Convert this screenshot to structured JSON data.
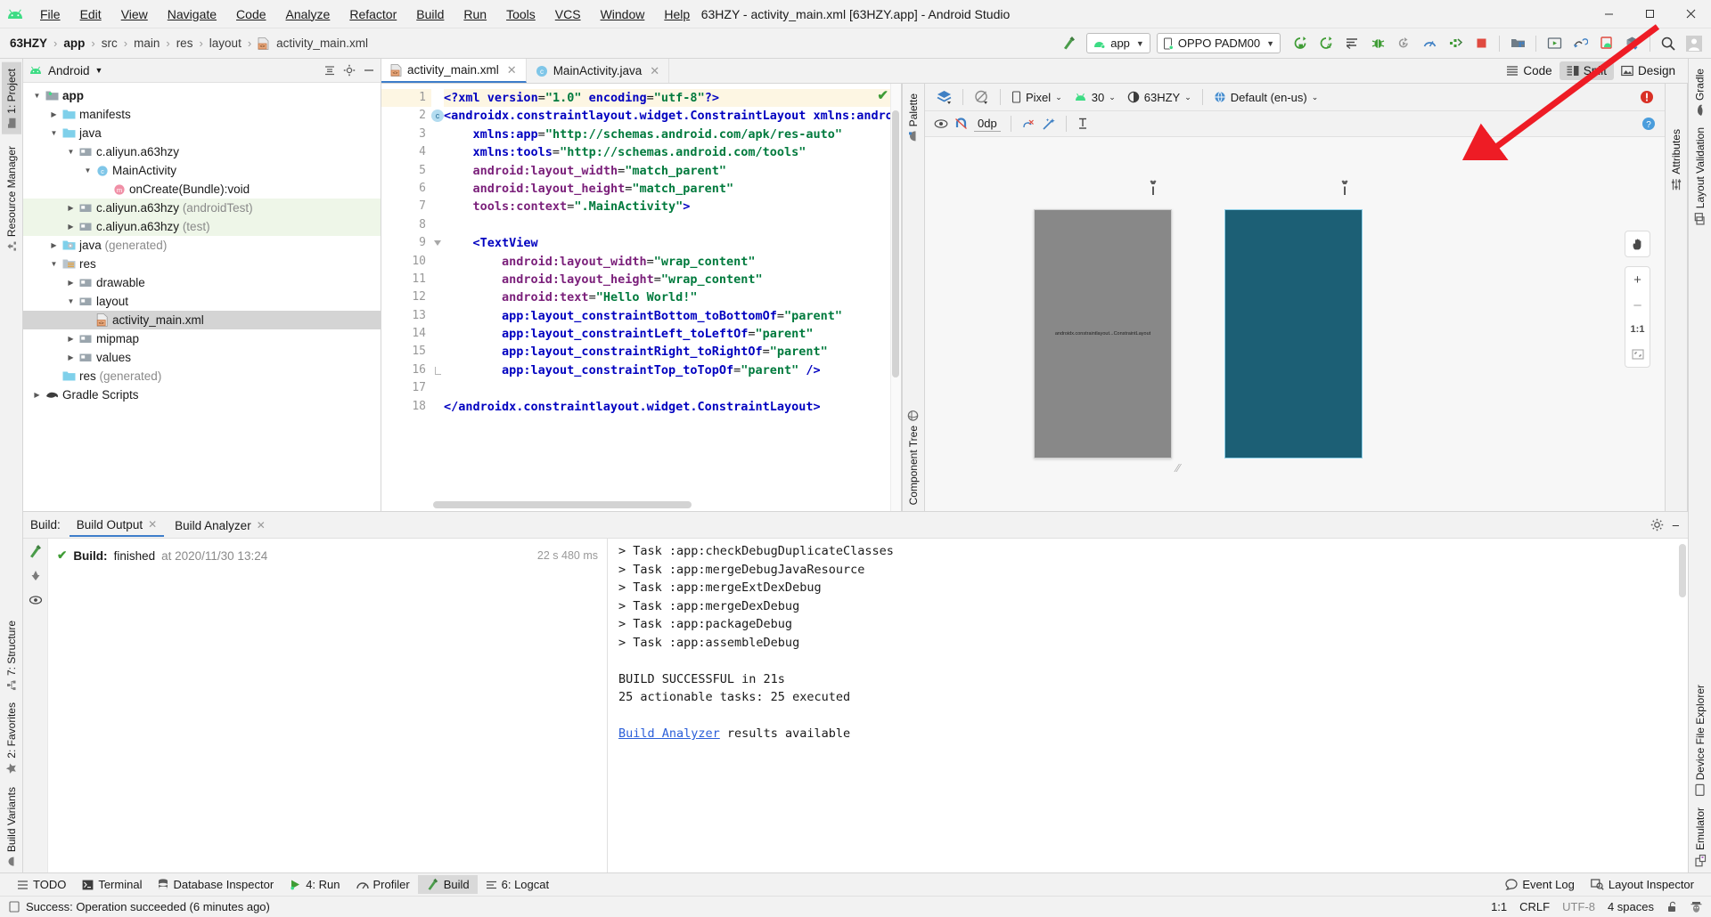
{
  "window": {
    "title": "63HZY - activity_main.xml [63HZY.app] - Android Studio",
    "minimize": "–",
    "maximize": "❐",
    "close": "✕"
  },
  "menu": [
    "File",
    "Edit",
    "View",
    "Navigate",
    "Code",
    "Analyze",
    "Refactor",
    "Build",
    "Run",
    "Tools",
    "VCS",
    "Window",
    "Help"
  ],
  "breadcrumb": {
    "items": [
      "63HZY",
      "app",
      "src",
      "main",
      "res",
      "layout",
      "activity_main.xml"
    ],
    "separator": "›"
  },
  "toolbar": {
    "module_selector": "app",
    "device_selector": "OPPO PADM00",
    "buttons": [
      "make-project-icon",
      "run-icon",
      "apply-changes-icon",
      "apply-code-changes-icon",
      "debug-icon",
      "attach-debugger-icon",
      "profiler-icon",
      "run-with-coverage-icon",
      "stop-icon",
      "avd-manager-icon",
      "sdk-manager-icon",
      "layout-inspector-icon",
      "device-manager-icon",
      "gradle-sync-icon",
      "search-icon",
      "avatar-icon"
    ]
  },
  "project_panel": {
    "title": "Android",
    "tree": [
      {
        "depth": 0,
        "arrow": "▼",
        "label": "app",
        "bold": true,
        "icon": "module-icon",
        "state": "normal"
      },
      {
        "depth": 1,
        "arrow": "▶",
        "label": "manifests",
        "icon": "folder-icon",
        "state": "normal"
      },
      {
        "depth": 1,
        "arrow": "▼",
        "label": "java",
        "icon": "folder-icon",
        "state": "normal"
      },
      {
        "depth": 2,
        "arrow": "▼",
        "label": "c.aliyun.a63hzy",
        "icon": "package-icon",
        "state": "normal"
      },
      {
        "depth": 3,
        "arrow": "▼",
        "label": "MainActivity",
        "icon": "class-icon",
        "state": "normal"
      },
      {
        "depth": 4,
        "arrow": "",
        "label": "onCreate(Bundle):void",
        "icon": "method-icon",
        "state": "normal"
      },
      {
        "depth": 2,
        "arrow": "▶",
        "label": "c.aliyun.a63hzy",
        "suffix": "(androidTest)",
        "icon": "package-icon",
        "state": "highlight"
      },
      {
        "depth": 2,
        "arrow": "▶",
        "label": "c.aliyun.a63hzy",
        "suffix": "(test)",
        "icon": "package-icon",
        "state": "highlight"
      },
      {
        "depth": 1,
        "arrow": "▶",
        "label": "java",
        "suffix": "(generated)",
        "icon": "folder-generated-icon",
        "state": "normal"
      },
      {
        "depth": 1,
        "arrow": "▼",
        "label": "res",
        "icon": "res-folder-icon",
        "state": "normal"
      },
      {
        "depth": 2,
        "arrow": "▶",
        "label": "drawable",
        "icon": "package-icon",
        "state": "normal"
      },
      {
        "depth": 2,
        "arrow": "▼",
        "label": "layout",
        "icon": "package-icon",
        "state": "normal"
      },
      {
        "depth": 3,
        "arrow": "",
        "label": "activity_main.xml",
        "icon": "xml-layout-icon",
        "state": "selected"
      },
      {
        "depth": 2,
        "arrow": "▶",
        "label": "mipmap",
        "icon": "package-icon",
        "state": "normal"
      },
      {
        "depth": 2,
        "arrow": "▶",
        "label": "values",
        "icon": "package-icon",
        "state": "normal"
      },
      {
        "depth": 1,
        "arrow": "",
        "label": "res",
        "suffix": "(generated)",
        "icon": "folder-icon",
        "state": "normal"
      },
      {
        "depth": 0,
        "arrow": "▶",
        "label": "Gradle Scripts",
        "icon": "gradle-icon",
        "state": "normal"
      }
    ]
  },
  "left_rail": [
    {
      "label": "1: Project",
      "selected": true,
      "icon": "project-icon"
    },
    {
      "label": "Resource Manager",
      "selected": false,
      "icon": "resource-icon"
    }
  ],
  "left_rail_bottom": [
    {
      "label": "7: Structure",
      "icon": "structure-icon"
    },
    {
      "label": "2: Favorites",
      "icon": "star-icon"
    },
    {
      "label": "Build Variants",
      "icon": "variants-icon"
    }
  ],
  "right_rail": [
    {
      "label": "Gradle",
      "icon": "gradle-elephant-icon"
    },
    {
      "label": "Layout Validation",
      "icon": "layout-validation-icon"
    }
  ],
  "right_rail_bottom": [
    {
      "label": "Device File Explorer",
      "icon": "device-file-icon"
    },
    {
      "label": "Emulator",
      "icon": "emulator-icon"
    }
  ],
  "editor": {
    "tabs": [
      {
        "label": "activity_main.xml",
        "icon": "xml-layout-icon",
        "active": true,
        "close": "✕"
      },
      {
        "label": "MainActivity.java",
        "icon": "class-icon",
        "active": false,
        "close": "✕"
      }
    ],
    "modes": [
      {
        "label": "Code",
        "icon": "code-view-icon",
        "selected": false
      },
      {
        "label": "Split",
        "icon": "split-view-icon",
        "selected": true
      },
      {
        "label": "Design",
        "icon": "design-view-icon",
        "selected": false
      }
    ],
    "code_lines": [
      {
        "n": 1,
        "current": true,
        "fold": "",
        "marker": "",
        "tokens": [
          {
            "t": "<?",
            "c": "pi"
          },
          {
            "t": "xml",
            "c": "pi"
          },
          {
            "t": " ",
            "c": "plain"
          },
          {
            "t": "version",
            "c": "pi"
          },
          {
            "t": "=",
            "c": "plain"
          },
          {
            "t": "\"1.0\"",
            "c": "val"
          },
          {
            "t": " ",
            "c": "plain"
          },
          {
            "t": "encoding",
            "c": "pi"
          },
          {
            "t": "=",
            "c": "plain"
          },
          {
            "t": "\"utf-8\"",
            "c": "val"
          },
          {
            "t": "?>",
            "c": "pi"
          }
        ]
      },
      {
        "n": 2,
        "current": false,
        "fold": "tri",
        "marker": "c",
        "tokens": [
          {
            "t": "<androidx.constraintlayout.widget.ConstraintLayout ",
            "c": "tag"
          },
          {
            "t": "xmlns:android",
            "c": "ns"
          },
          {
            "t": "=",
            "c": "plain"
          },
          {
            "t": "\"ht",
            "c": "val"
          }
        ]
      },
      {
        "n": 3,
        "current": false,
        "fold": "",
        "marker": "",
        "tokens": [
          {
            "t": "    ",
            "c": "plain"
          },
          {
            "t": "xmlns:app",
            "c": "ns"
          },
          {
            "t": "=",
            "c": "plain"
          },
          {
            "t": "\"http://schemas.android.com/apk/res-auto\"",
            "c": "val"
          }
        ]
      },
      {
        "n": 4,
        "current": false,
        "fold": "",
        "marker": "",
        "tokens": [
          {
            "t": "    ",
            "c": "plain"
          },
          {
            "t": "xmlns:tools",
            "c": "ns"
          },
          {
            "t": "=",
            "c": "plain"
          },
          {
            "t": "\"http://schemas.android.com/tools\"",
            "c": "val"
          }
        ]
      },
      {
        "n": 5,
        "current": false,
        "fold": "",
        "marker": "",
        "tokens": [
          {
            "t": "    ",
            "c": "plain"
          },
          {
            "t": "android:layout_width",
            "c": "attr"
          },
          {
            "t": "=",
            "c": "plain"
          },
          {
            "t": "\"match_parent\"",
            "c": "val"
          }
        ]
      },
      {
        "n": 6,
        "current": false,
        "fold": "",
        "marker": "",
        "tokens": [
          {
            "t": "    ",
            "c": "plain"
          },
          {
            "t": "android:layout_height",
            "c": "attr"
          },
          {
            "t": "=",
            "c": "plain"
          },
          {
            "t": "\"match_parent\"",
            "c": "val"
          }
        ]
      },
      {
        "n": 7,
        "current": false,
        "fold": "",
        "marker": "",
        "tokens": [
          {
            "t": "    ",
            "c": "plain"
          },
          {
            "t": "tools:context",
            "c": "attr"
          },
          {
            "t": "=",
            "c": "plain"
          },
          {
            "t": "\".MainActivity\"",
            "c": "val"
          },
          {
            "t": ">",
            "c": "tag"
          }
        ]
      },
      {
        "n": 8,
        "current": false,
        "fold": "",
        "marker": "",
        "tokens": []
      },
      {
        "n": 9,
        "current": false,
        "fold": "tri",
        "marker": "",
        "tokens": [
          {
            "t": "    ",
            "c": "plain"
          },
          {
            "t": "<TextView",
            "c": "tag"
          }
        ]
      },
      {
        "n": 10,
        "current": false,
        "fold": "",
        "marker": "",
        "tokens": [
          {
            "t": "        ",
            "c": "plain"
          },
          {
            "t": "android:layout_width",
            "c": "attr"
          },
          {
            "t": "=",
            "c": "plain"
          },
          {
            "t": "\"wrap_content\"",
            "c": "val"
          }
        ]
      },
      {
        "n": 11,
        "current": false,
        "fold": "",
        "marker": "",
        "tokens": [
          {
            "t": "        ",
            "c": "plain"
          },
          {
            "t": "android:layout_height",
            "c": "attr"
          },
          {
            "t": "=",
            "c": "plain"
          },
          {
            "t": "\"wrap_content\"",
            "c": "val"
          }
        ]
      },
      {
        "n": 12,
        "current": false,
        "fold": "",
        "marker": "",
        "tokens": [
          {
            "t": "        ",
            "c": "plain"
          },
          {
            "t": "android:text",
            "c": "attr"
          },
          {
            "t": "=",
            "c": "plain"
          },
          {
            "t": "\"Hello World!\"",
            "c": "val"
          }
        ]
      },
      {
        "n": 13,
        "current": false,
        "fold": "",
        "marker": "",
        "tokens": [
          {
            "t": "        ",
            "c": "plain"
          },
          {
            "t": "app:layout_constraintBottom_toBottomOf",
            "c": "ns"
          },
          {
            "t": "=",
            "c": "plain"
          },
          {
            "t": "\"parent\"",
            "c": "val"
          }
        ]
      },
      {
        "n": 14,
        "current": false,
        "fold": "",
        "marker": "",
        "tokens": [
          {
            "t": "        ",
            "c": "plain"
          },
          {
            "t": "app:layout_constraintLeft_toLeftOf",
            "c": "ns"
          },
          {
            "t": "=",
            "c": "plain"
          },
          {
            "t": "\"parent\"",
            "c": "val"
          }
        ]
      },
      {
        "n": 15,
        "current": false,
        "fold": "",
        "marker": "",
        "tokens": [
          {
            "t": "        ",
            "c": "plain"
          },
          {
            "t": "app:layout_constraintRight_toRightOf",
            "c": "ns"
          },
          {
            "t": "=",
            "c": "plain"
          },
          {
            "t": "\"parent\"",
            "c": "val"
          }
        ]
      },
      {
        "n": 16,
        "current": false,
        "fold": "br",
        "marker": "",
        "tokens": [
          {
            "t": "        ",
            "c": "plain"
          },
          {
            "t": "app:layout_constraintTop_toTopOf",
            "c": "ns"
          },
          {
            "t": "=",
            "c": "plain"
          },
          {
            "t": "\"parent\"",
            "c": "val"
          },
          {
            "t": " />",
            "c": "tag"
          }
        ]
      },
      {
        "n": 17,
        "current": false,
        "fold": "",
        "marker": "",
        "tokens": []
      },
      {
        "n": 18,
        "current": false,
        "fold": "",
        "marker": "",
        "tokens": [
          {
            "t": "</androidx.constraintlayout.widget.ConstraintLayout>",
            "c": "tag"
          }
        ]
      }
    ]
  },
  "palette_rail": [
    {
      "label": "Palette",
      "icon": "palette-icon"
    },
    {
      "label": "Component Tree",
      "icon": "component-tree-icon"
    }
  ],
  "design": {
    "toolbar_top": {
      "design_surface_icon": "layers-icon",
      "orientation_icon": "rotate-icon",
      "device": "Pixel",
      "api_level": "30",
      "theme": "63HZY",
      "locale": "Default (en-us)",
      "error_icon": "error-icon"
    },
    "toolbar_second": {
      "items": [
        "eye-icon",
        "magnet-icon",
        "margin-value",
        "constraints-icon",
        "magic-icon",
        "baseline-icon"
      ],
      "margin": "0dp",
      "help_icon": "help-icon"
    },
    "preview_label": "androidx.constraintlayout...ConstraintLayout",
    "zoom_controls": {
      "pan": "pan-hand-icon",
      "zoom_in": "+",
      "zoom_out": "–",
      "actual_size": "1:1",
      "fit_screen": "fit-screen-icon"
    },
    "colors": {
      "device_fill": "#888888",
      "blueprint_fill": "#1c5f75",
      "blueprint_stroke": "#8fd0e8"
    }
  },
  "attributes_rail": {
    "label": "Attributes",
    "icon": "attributes-icon"
  },
  "build_panel": {
    "title": "Build:",
    "tabs": [
      {
        "label": "Build Output",
        "active": true,
        "close": "✕"
      },
      {
        "label": "Build Analyzer",
        "active": false,
        "close": "✕"
      }
    ],
    "tree_entry": {
      "status_icon": "green-check-icon",
      "bold": "Build:",
      "text": "finished",
      "timestamp": "at 2020/11/30 13:24",
      "duration": "22 s 480 ms"
    },
    "log_lines": [
      "> Task :app:checkDebugDuplicateClasses",
      "> Task :app:mergeDebugJavaResource",
      "> Task :app:mergeExtDexDebug",
      "> Task :app:mergeDexDebug",
      "> Task :app:packageDebug",
      "> Task :app:assembleDebug",
      "",
      "BUILD SUCCESSFUL in 21s",
      "25 actionable tasks: 25 executed",
      ""
    ],
    "log_link": "Build Analyzer",
    "log_link_suffix": " results available",
    "settings_icon": "gear-icon",
    "minimize_icon": "–"
  },
  "tool_windows": [
    {
      "label": "TODO",
      "icon": "todo-icon",
      "selected": false
    },
    {
      "label": "Terminal",
      "icon": "terminal-icon",
      "selected": false
    },
    {
      "label": "Database Inspector",
      "icon": "database-icon",
      "selected": false
    },
    {
      "label": "4: Run",
      "icon": "run-icon",
      "selected": false
    },
    {
      "label": "Profiler",
      "icon": "profiler-icon",
      "selected": false
    },
    {
      "label": "Build",
      "icon": "build-hammer-icon",
      "selected": true
    },
    {
      "label": "6: Logcat",
      "icon": "logcat-icon",
      "selected": false
    }
  ],
  "tool_windows_right": [
    {
      "label": "Event Log",
      "icon": "event-log-icon"
    },
    {
      "label": "Layout Inspector",
      "icon": "layout-inspector-icon"
    }
  ],
  "status_bar": {
    "icon": "status-icon",
    "message": "Success: Operation succeeded (6 minutes ago)",
    "caret": "1:1",
    "line_ending": "CRLF",
    "encoding": "UTF-8",
    "indent": "4 spaces",
    "lock_icon": "unlock-icon",
    "inspector_icon": "hector-icon"
  },
  "annotation": {
    "arrow_color": "#ee1c25"
  }
}
